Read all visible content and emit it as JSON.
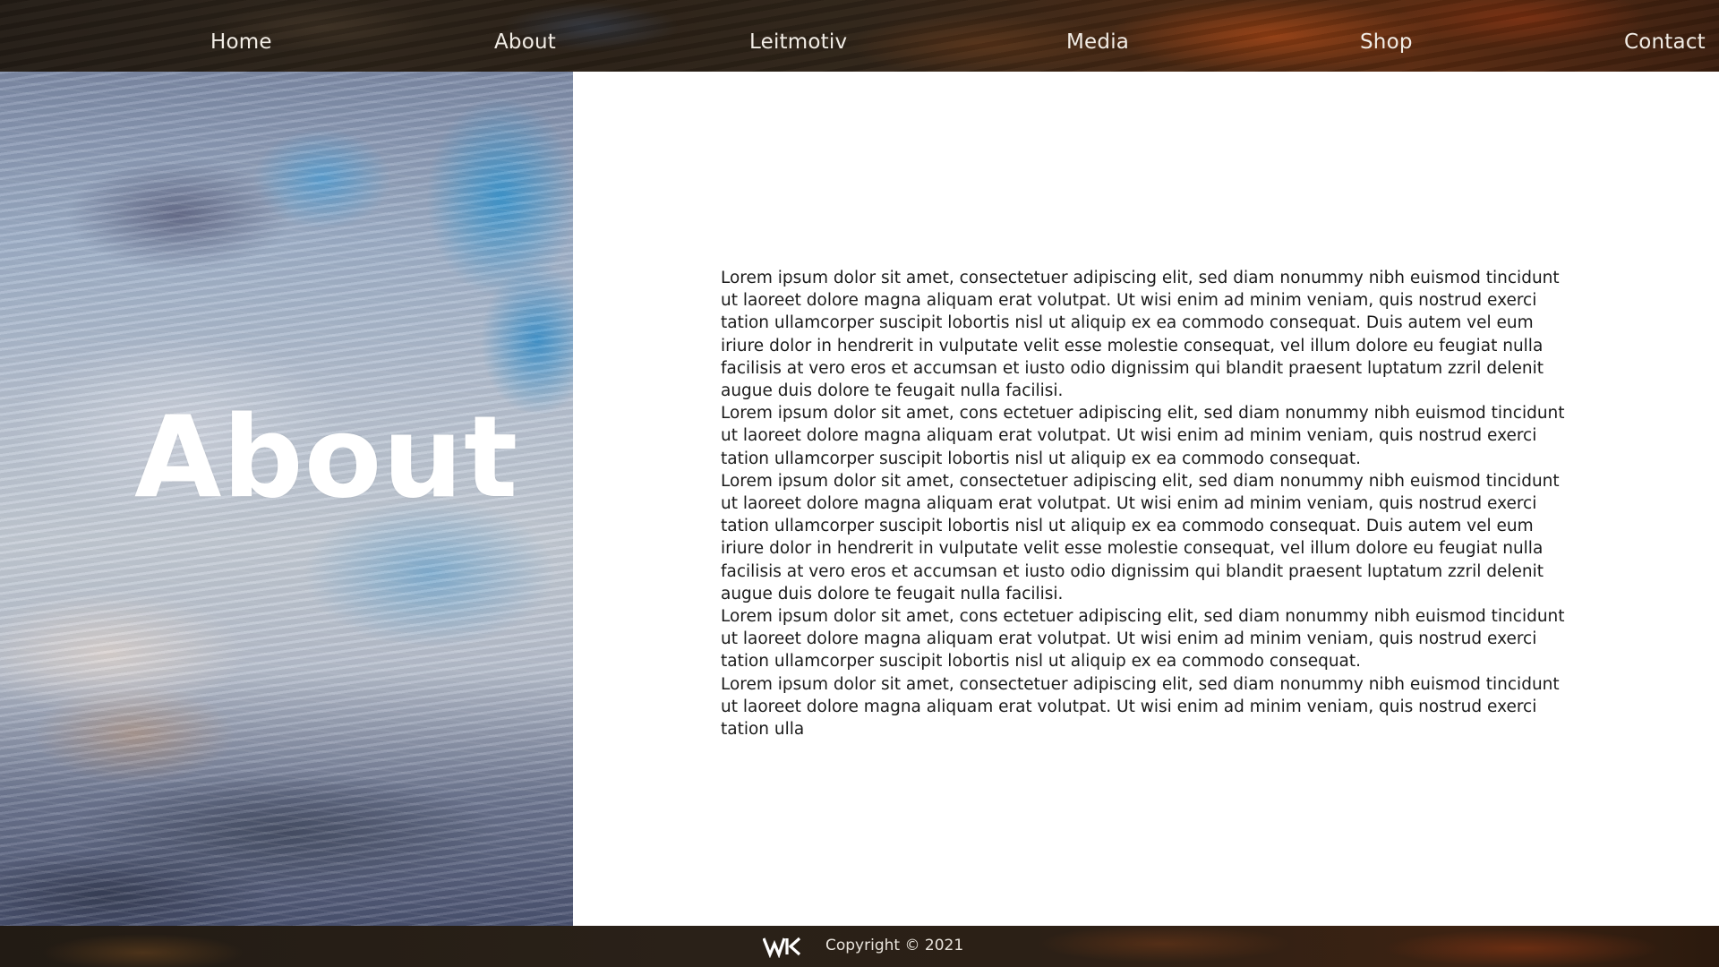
{
  "nav": {
    "items": [
      {
        "label": "Home"
      },
      {
        "label": "About"
      },
      {
        "label": "Leitmotiv"
      },
      {
        "label": "Media"
      },
      {
        "label": "Shop"
      },
      {
        "label": "Contact"
      }
    ]
  },
  "hero": {
    "title": "About"
  },
  "content": {
    "paragraphs": [
      "Lorem ipsum dolor sit amet, consectetuer adipiscing elit, sed diam nonummy nibh euismod tincidunt ut laoreet dolore magna aliquam erat volutpat. Ut wisi enim ad minim veniam, quis nostrud exerci tation ulla­mcorper suscipit lobortis nisl ut aliquip ex ea commodo consequat. Duis autem vel eum iriure dolor in hendrerit in vulputate velit esse molestie consequat, vel illum dolore eu feugiat nulla facilisis at vero eros et accumsan et iusto odio dignissim qui blandit praesent luptatum zzril delenit augue duis dolore te feu­gait nulla facilisi.",
      "Lorem ipsum dolor sit amet, cons ectetuer adipiscing elit, sed diam nonummy nibh euismod tincidunt ut laoreet dolore magna aliquam erat volutpat. Ut wisi enim ad minim veniam, quis nostrud exerci tation ulla­mcorper suscipit lobortis nisl ut aliquip ex ea commodo consequat.",
      "Lorem ipsum dolor sit amet, consectetuer adipiscing elit, sed diam nonummy nibh euismod tincidunt ut laoreet dolore magna aliquam erat volutpat. Ut wisi enim ad minim veniam, quis nostrud exerci tation ulla­mcorper suscipit lobortis nisl ut aliquip ex ea commodo consequat. Duis autem vel eum iriure dolor in hendrerit in vulputate velit esse molestie consequat, vel illum dolore eu feugiat nulla facilisis at vero eros et accumsan et iusto odio dignissim qui blandit praesent luptatum zzril delenit augue duis dolore te feu­gait nulla facilisi.",
      "Lorem ipsum dolor sit amet, cons ectetuer adipiscing elit, sed diam nonummy nibh euismod tincidunt ut laoreet dolore magna aliquam erat volutpat. Ut wisi enim ad minim veniam, quis nostrud exerci tation ulla­mcorper suscipit lobortis nisl ut aliquip ex ea commodo consequat.",
      "Lorem ipsum dolor sit amet, consectetuer adipiscing elit, sed diam nonummy nibh euismod tincidunt ut laoreet dolore magna aliquam erat volutpat. Ut wisi enim ad minim veniam, quis nostrud exerci tation ulla"
    ]
  },
  "footer": {
    "logo_icon": "wk-logo-icon",
    "copyright": "Copyright © 2021"
  }
}
